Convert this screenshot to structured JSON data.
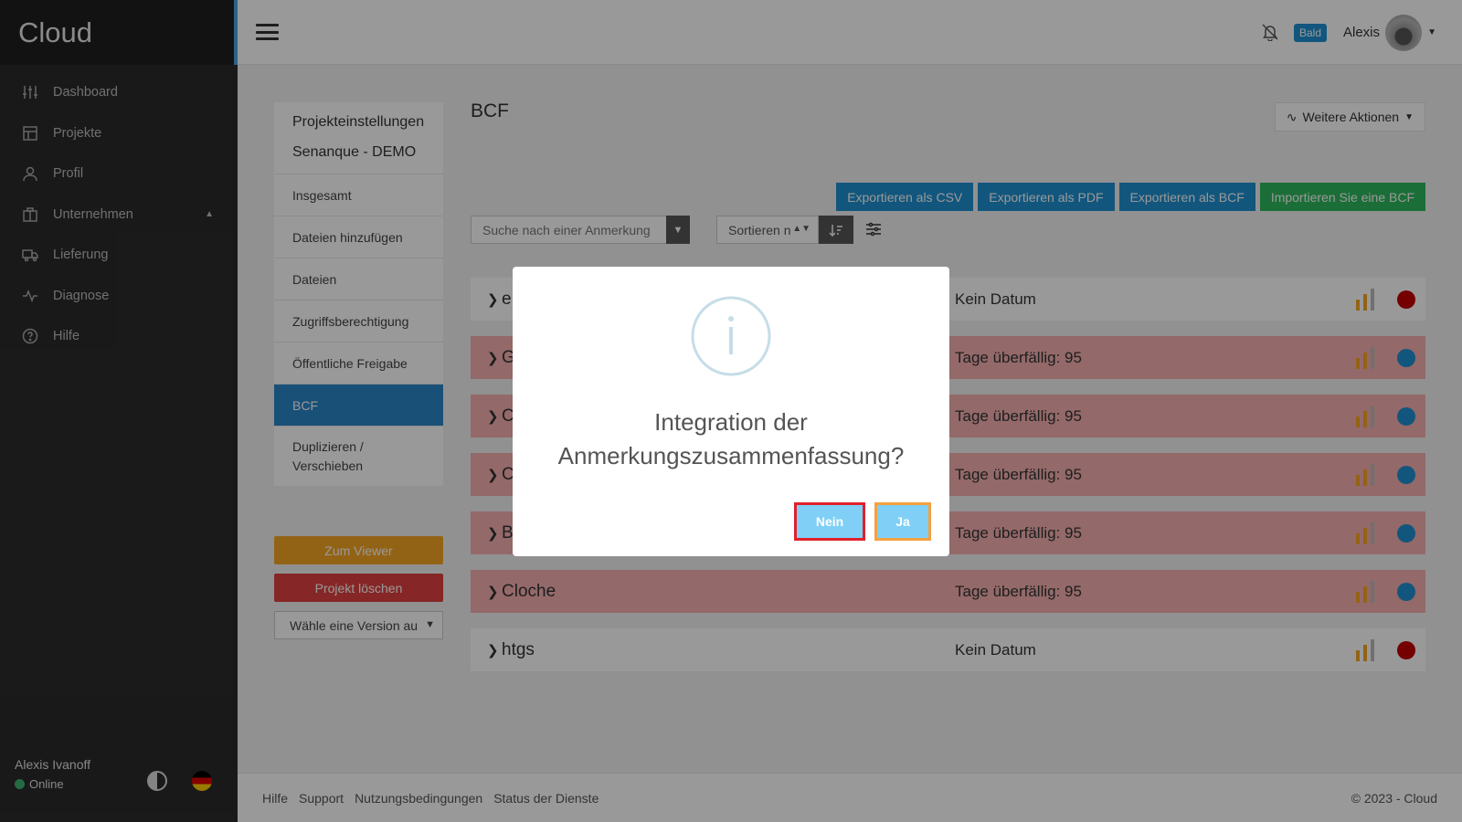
{
  "brand": "Cloud",
  "sidebar": {
    "items": [
      {
        "label": "Dashboard",
        "icon": "sliders-icon"
      },
      {
        "label": "Projekte",
        "icon": "layout-icon"
      },
      {
        "label": "Profil",
        "icon": "user-icon"
      },
      {
        "label": "Unternehmen",
        "icon": "building-icon"
      },
      {
        "label": "Lieferung",
        "icon": "truck-icon"
      },
      {
        "label": "Diagnose",
        "icon": "activity-icon"
      },
      {
        "label": "Hilfe",
        "icon": "help-icon"
      }
    ],
    "user_name": "Alexis Ivanoff",
    "user_status": "Online"
  },
  "header": {
    "badge": "Bald",
    "user": "Alexis"
  },
  "settings": {
    "title": "Projekteinstellungen",
    "project": "Senanque - DEMO",
    "items": [
      "Insgesamt",
      "Dateien hinzufügen",
      "Dateien",
      "Zugriffsberechtigung",
      "Öffentliche Freigabe",
      "BCF",
      "Duplizieren / Verschieben"
    ],
    "viewer_btn": "Zum Viewer",
    "delete_btn": "Projekt löschen",
    "version_placeholder": "Wähle eine Version au"
  },
  "main": {
    "title": "BCF",
    "more_actions": "Weitere Aktionen",
    "export_csv": "Exportieren als CSV",
    "export_pdf": "Exportieren als PDF",
    "export_bcf": "Exportieren als BCF",
    "import_bcf": "Importieren Sie eine BCF",
    "search_placeholder": "Suche nach einer Anmerkung",
    "sort_label": "Sortieren n",
    "rows": [
      {
        "name": "e",
        "date": "Kein Datum",
        "overdue": false,
        "status_color": "#c40000"
      },
      {
        "name": "G",
        "date": "Tage überfällig: 95",
        "overdue": true,
        "status_color": "#1f8fd0"
      },
      {
        "name": "C",
        "date": "Tage überfällig: 95",
        "overdue": true,
        "status_color": "#1f8fd0"
      },
      {
        "name": "C",
        "date": "Tage überfällig: 95",
        "overdue": true,
        "status_color": "#1f8fd0"
      },
      {
        "name": "B",
        "date": "Tage überfällig: 95",
        "overdue": true,
        "status_color": "#1f8fd0"
      },
      {
        "name": "Cloche",
        "date": "Tage überfällig: 95",
        "overdue": true,
        "status_color": "#1f8fd0"
      },
      {
        "name": "htgs",
        "date": "Kein Datum",
        "overdue": false,
        "status_color": "#c40000"
      }
    ]
  },
  "footer": {
    "links": [
      "Hilfe",
      "Support",
      "Nutzungsbedingungen",
      "Status der Dienste"
    ],
    "copyright": "© 2023 - Cloud"
  },
  "modal": {
    "question_line1": "Integration der",
    "question_line2": "Anmerkungszusammenfassung?",
    "no_label": "Nein",
    "yes_label": "Ja"
  }
}
